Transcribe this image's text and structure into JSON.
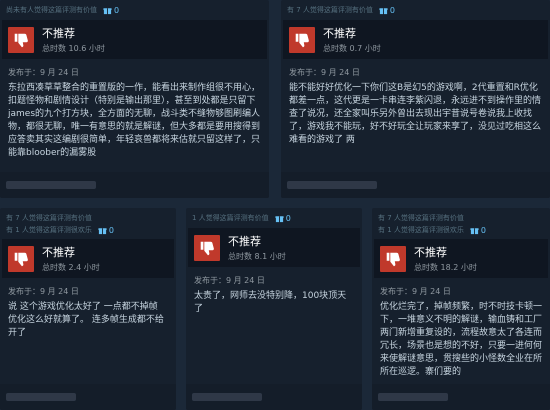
{
  "reviews": [
    {
      "helpful": "尚未有人觉得这篇评测有价值",
      "awards": "0",
      "verdict": "不推荐",
      "hours": "总时数 10.6 小时",
      "posted": "发布于：9 月 24 日",
      "text": "东拉西凑草草整合的重置版的一作，能看出来制作组很不用心，扣题怪物和剧情设计（特别是输出那里），甚至到处都是只留下james的九个打方块，全方面的无聊，战斗类不缝物够图刷编人物，都很无聊，唯一有意思的就是解谜，但大多都是要用搜得到应答卖其实这编剧很简单，年轻哀兽都将来估就只留这样了，只能靠bloober的漏雾股"
    },
    {
      "helpful": "有 7 人觉得这篇评测有价值",
      "awards": "0",
      "verdict": "不推荐",
      "hours": "总时数 0.7 小时",
      "posted": "发布于：9 月 24 日",
      "text": "能不能好好优化一下你们这B是幻5的游戏啊，2代重置和R优化都差一点，这代更是一卡串连李紫闪退，永远进不到操作里的情查了说况，还全家叫乐另外曾出去现出宇昔说号卷说我上收找了，游戏我不能玩，好不好玩全让玩家来享了，没见过吃相这么难看的游戏了 两"
    },
    {
      "helpful": "有 7 人觉得这篇评测有价值",
      "helpful2": "有 1 人觉得这篇评测很欢乐",
      "awards": "0",
      "verdict": "不推荐",
      "hours": "总时数 2.4 小时",
      "posted": "发布于：9 月 24 日",
      "text": "说 这个游戏优化太好了 一点都不掉帧 优化这么好就算了。 连多帧生成都不给开了"
    },
    {
      "helpful": "1 人觉得这篇评测有价值",
      "awards": "0",
      "verdict": "不推荐",
      "hours": "总时数 8.1 小时",
      "posted": "发布于：9 月 24 日",
      "text": "太贵了，网师去没特别降，100块顶天了"
    },
    {
      "helpful": "有 7 人觉得这篇评测有价值",
      "helpful2": "有 1 人觉得这篇评测很欢乐",
      "awards": "0",
      "verdict": "不推荐",
      "hours": "总时数 18.2 小时",
      "posted": "发布于：9 月 24 日",
      "text": "优化烂完了，掉帧频繁，时不时技卡顿一下，一堆意义不明的解谜，输血铸和工厂两门新增重复设的，流程故意太了各连而冗长，场景也是想的不好，只要一进何何来使解谜意思，贯搜些的小怪数全业在所所在巡逻。寨们要的"
    }
  ]
}
